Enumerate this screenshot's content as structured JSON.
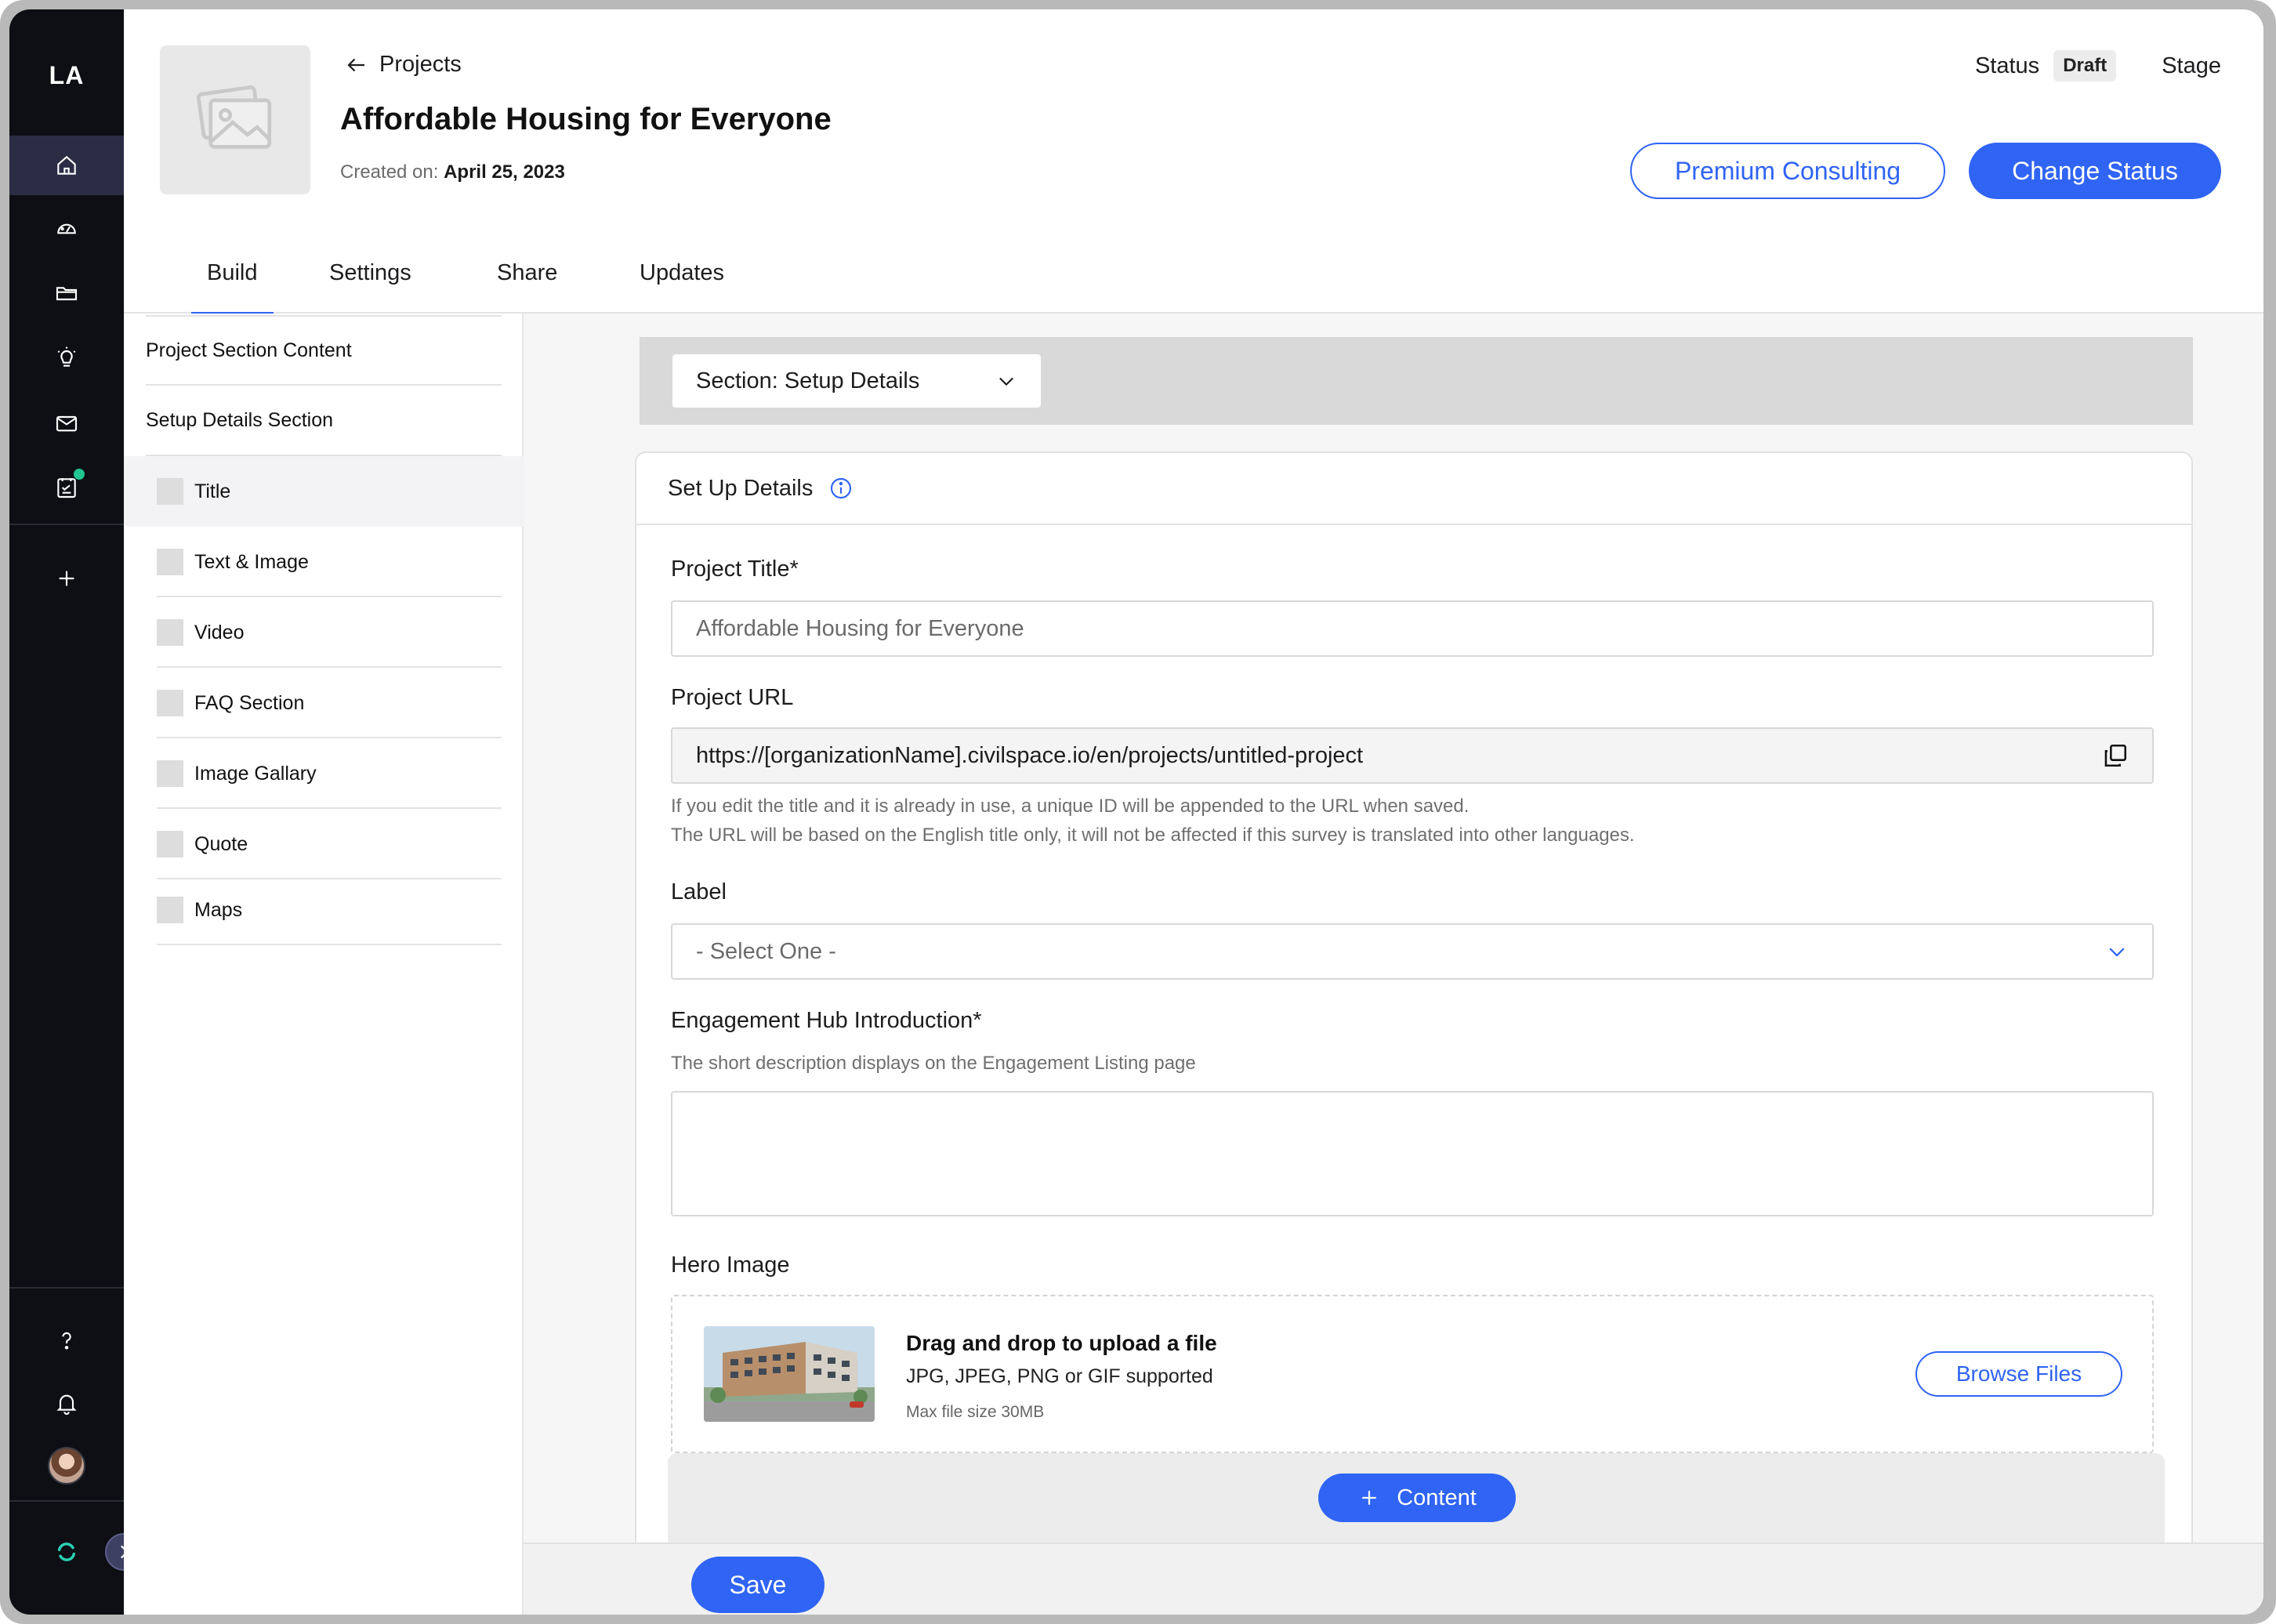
{
  "rail": {
    "logo": "LA",
    "icons": [
      "home-icon",
      "dashboard-icon",
      "folder-icon",
      "lightbulb-icon",
      "mail-icon",
      "survey-icon",
      "plus-icon",
      "help-icon",
      "bell-icon",
      "avatar",
      "brand-icon",
      "expand-icon"
    ]
  },
  "header": {
    "back_label": "Projects",
    "title": "Affordable Housing for Everyone",
    "created_label": "Created on:",
    "created_date": "April 25, 2023",
    "status_label": "Status",
    "status_value": "Draft",
    "stage_label": "Stage",
    "premium_button": "Premium Consulting",
    "change_status_button": "Change Status"
  },
  "tabs": [
    {
      "label": "Build",
      "active": true
    },
    {
      "label": "Settings",
      "active": false
    },
    {
      "label": "Share",
      "active": false
    },
    {
      "label": "Updates",
      "active": false
    }
  ],
  "left_panel": {
    "heading_1": "Project Section Content",
    "heading_2": "Setup Details Section",
    "items": [
      {
        "label": "Title",
        "active": true
      },
      {
        "label": "Text & Image",
        "active": false
      },
      {
        "label": "Video",
        "active": false
      },
      {
        "label": "FAQ Section",
        "active": false
      },
      {
        "label": "Image Gallary",
        "active": false
      },
      {
        "label": "Quote",
        "active": false
      },
      {
        "label": "Maps",
        "active": false
      }
    ]
  },
  "main": {
    "section_select": "Section: Setup Details",
    "card_title": "Set Up Details",
    "project_title_label": "Project Title*",
    "project_title_value": "Affordable Housing for Everyone",
    "project_url_label": "Project URL",
    "project_url_value": "https://[organizationName].civilspace.io/en/projects/untitled-project",
    "url_help_1": "If you edit the title and it is already in use, a unique ID will be appended to the URL when saved.",
    "url_help_2": "The URL will be based on the English title only, it will not be affected if this survey is translated into other languages.",
    "label_label": "Label",
    "label_placeholder": "- Select One -",
    "intro_label": "Engagement Hub Introduction*",
    "intro_help": "The short description displays on the Engagement Listing page",
    "intro_value": "",
    "hero_label": "Hero Image",
    "dropzone_title": "Drag and drop to upload a file",
    "dropzone_formats": "JPG, JPEG, PNG or GIF supported",
    "dropzone_max": "Max file size 30MB",
    "browse_button": "Browse Files",
    "content_button": "Content",
    "save_button": "Save"
  },
  "colors": {
    "accent": "#2f64f5",
    "rail_bg": "#0d0f15",
    "rail_active": "#2b2d45",
    "notification_dot": "#21c58f"
  }
}
